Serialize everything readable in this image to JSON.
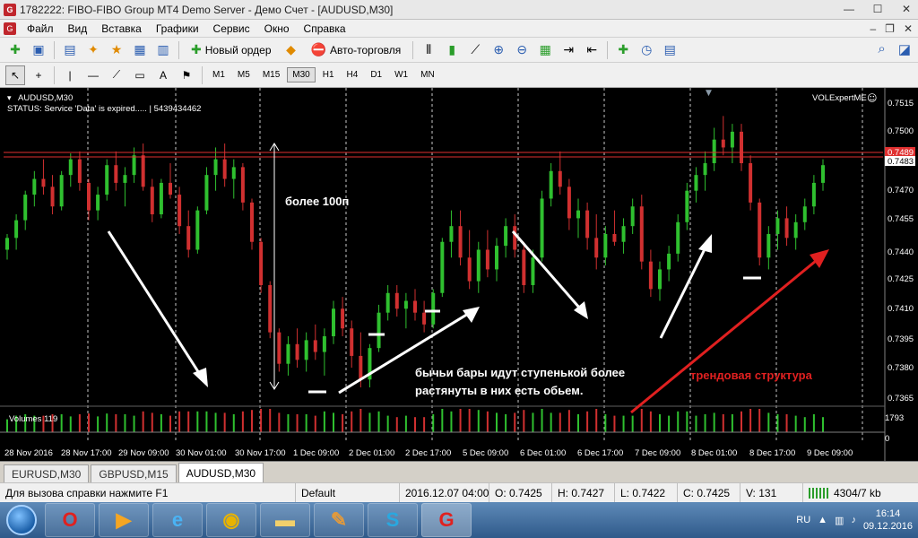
{
  "window": {
    "title": "1782222: FIBO-FIBO Group MT4 Demo Server - Демо Счет - [AUDUSD,M30]",
    "icon": "G"
  },
  "menu": [
    "Файл",
    "Вид",
    "Вставка",
    "Графики",
    "Сервис",
    "Окно",
    "Справка"
  ],
  "toolbar": {
    "new_order": "Новый ордер",
    "auto_trading": "Авто-торговля"
  },
  "draw_tools": [
    "↖",
    "+",
    "|",
    "—",
    "⟋",
    "▭",
    "A",
    "⚑"
  ],
  "timeframes": [
    "M1",
    "M5",
    "M15",
    "M30",
    "H1",
    "H4",
    "D1",
    "W1",
    "MN"
  ],
  "active_timeframe": "M30",
  "chart": {
    "symbol_line": "AUDUSD,M30",
    "status_line": "STATUS:  Service 'Data' is expired.....  | 5439434462",
    "expert": "VOLExpertME",
    "volumes_label": "Volumes 119",
    "volume_scale_top": "1793",
    "volume_scale_bottom": "0",
    "price_axis": [
      "0.7515",
      "0.7500",
      "0.7485",
      "0.7470",
      "0.7455",
      "0.7440",
      "0.7425",
      "0.7410",
      "0.7395",
      "0.7380",
      "0.7365"
    ],
    "price_label_red": "0.7489",
    "price_label_current": "0.7483",
    "time_axis": [
      "28 Nov 2016",
      "28 Nov 17:00",
      "29 Nov 09:00",
      "30 Nov 01:00",
      "30 Nov 17:00",
      "1 Dec 09:00",
      "2 Dec 01:00",
      "2 Dec 17:00",
      "5 Dec 09:00",
      "6 Dec 01:00",
      "6 Dec 17:00",
      "7 Dec 09:00",
      "8 Dec 01:00",
      "8 Dec 17:00",
      "9 Dec 09:00"
    ],
    "annotation_range": "более 100п",
    "annotation_bull": "бычьи бары идут ступенькой более растянуты в них есть обьем.",
    "annotation_trend": "трендовая структура"
  },
  "tabs": [
    "EURUSD,M30",
    "GBPUSD,M15",
    "AUDUSD,M30"
  ],
  "active_tab": "AUDUSD,M30",
  "status": {
    "help": "Для вызова справки нажмите F1",
    "profile": "Default",
    "datetime": "2016.12.07 04:00",
    "open": "O: 0.7425",
    "high": "H: 0.7427",
    "low": "L: 0.7422",
    "close": "C: 0.7425",
    "volume": "V: 131",
    "traffic": "4304/7 kb"
  },
  "taskbar": {
    "lang": "RU",
    "time": "16:14",
    "date": "09.12.2016"
  },
  "colors": {
    "bull": "#2fc02f",
    "bear": "#d03030",
    "level_line": "#e03030",
    "arrow_white": "#ffffff",
    "arrow_red": "#e02020"
  },
  "candles": [
    [
      0.744,
      0.7448,
      0.7435,
      0.7446
    ],
    [
      0.7446,
      0.7458,
      0.744,
      0.7455
    ],
    [
      0.7455,
      0.747,
      0.745,
      0.7468
    ],
    [
      0.7468,
      0.748,
      0.7462,
      0.7476
    ],
    [
      0.7476,
      0.7486,
      0.7468,
      0.7472
    ],
    [
      0.7472,
      0.7478,
      0.7458,
      0.7462
    ],
    [
      0.7462,
      0.748,
      0.746,
      0.7478
    ],
    [
      0.7478,
      0.7489,
      0.7472,
      0.7486
    ],
    [
      0.7486,
      0.749,
      0.747,
      0.7474
    ],
    [
      0.7474,
      0.7476,
      0.7455,
      0.746
    ],
    [
      0.746,
      0.7472,
      0.7455,
      0.7468
    ],
    [
      0.7468,
      0.7486,
      0.7465,
      0.7483
    ],
    [
      0.7483,
      0.749,
      0.747,
      0.7474
    ],
    [
      0.7474,
      0.7482,
      0.7462,
      0.7478
    ],
    [
      0.7478,
      0.7492,
      0.7474,
      0.7488
    ],
    [
      0.7488,
      0.7494,
      0.747,
      0.7472
    ],
    [
      0.7472,
      0.7476,
      0.7454,
      0.7458
    ],
    [
      0.7458,
      0.7476,
      0.7456,
      0.7474
    ],
    [
      0.7474,
      0.7484,
      0.7466,
      0.7468
    ],
    [
      0.7468,
      0.7472,
      0.7448,
      0.7452
    ],
    [
      0.7452,
      0.746,
      0.7436,
      0.744
    ],
    [
      0.744,
      0.7462,
      0.7438,
      0.746
    ],
    [
      0.746,
      0.7482,
      0.7458,
      0.7478
    ],
    [
      0.7478,
      0.7492,
      0.747,
      0.7486
    ],
    [
      0.7486,
      0.7494,
      0.7472,
      0.7476
    ],
    [
      0.7476,
      0.7486,
      0.7466,
      0.7482
    ],
    [
      0.7482,
      0.7484,
      0.746,
      0.7464
    ],
    [
      0.7464,
      0.7466,
      0.744,
      0.7444
    ],
    [
      0.7444,
      0.7446,
      0.7418,
      0.7422
    ],
    [
      0.7422,
      0.7424,
      0.7395,
      0.7398
    ],
    [
      0.7398,
      0.74,
      0.7378,
      0.7382
    ],
    [
      0.7382,
      0.7396,
      0.7376,
      0.7392
    ],
    [
      0.7392,
      0.74,
      0.738,
      0.7384
    ],
    [
      0.7384,
      0.7398,
      0.7378,
      0.7394
    ],
    [
      0.7394,
      0.7402,
      0.7384,
      0.7388
    ],
    [
      0.7388,
      0.74,
      0.7376,
      0.7396
    ],
    [
      0.7396,
      0.7414,
      0.7392,
      0.741
    ],
    [
      0.741,
      0.7416,
      0.7396,
      0.74
    ],
    [
      0.74,
      0.7404,
      0.738,
      0.7386
    ],
    [
      0.7386,
      0.7398,
      0.737,
      0.7374
    ],
    [
      0.7374,
      0.7392,
      0.737,
      0.739
    ],
    [
      0.739,
      0.7412,
      0.7388,
      0.7408
    ],
    [
      0.7408,
      0.7422,
      0.7404,
      0.7418
    ],
    [
      0.7418,
      0.7422,
      0.7406,
      0.741
    ],
    [
      0.741,
      0.7418,
      0.74,
      0.7414
    ],
    [
      0.7414,
      0.742,
      0.7404,
      0.7408
    ],
    [
      0.7408,
      0.7414,
      0.7398,
      0.7402
    ],
    [
      0.7402,
      0.742,
      0.74,
      0.7418
    ],
    [
      0.7418,
      0.7446,
      0.7416,
      0.7444
    ],
    [
      0.7444,
      0.746,
      0.7436,
      0.7452
    ],
    [
      0.7452,
      0.746,
      0.7432,
      0.7436
    ],
    [
      0.7436,
      0.745,
      0.742,
      0.7424
    ],
    [
      0.7424,
      0.7444,
      0.7418,
      0.744
    ],
    [
      0.744,
      0.745,
      0.7426,
      0.743
    ],
    [
      0.743,
      0.7446,
      0.7424,
      0.7442
    ],
    [
      0.7442,
      0.7456,
      0.7436,
      0.7452
    ],
    [
      0.7452,
      0.7458,
      0.7436,
      0.744
    ],
    [
      0.744,
      0.7444,
      0.7418,
      0.7422
    ],
    [
      0.7422,
      0.744,
      0.7418,
      0.7436
    ],
    [
      0.7436,
      0.747,
      0.7434,
      0.7466
    ],
    [
      0.7466,
      0.7484,
      0.7462,
      0.748
    ],
    [
      0.748,
      0.749,
      0.7468,
      0.7472
    ],
    [
      0.7472,
      0.7476,
      0.745,
      0.7456
    ],
    [
      0.7456,
      0.7466,
      0.7446,
      0.746
    ],
    [
      0.746,
      0.7464,
      0.744,
      0.7446
    ],
    [
      0.7446,
      0.7458,
      0.743,
      0.7436
    ],
    [
      0.7436,
      0.7452,
      0.7432,
      0.7448
    ],
    [
      0.7448,
      0.746,
      0.7442,
      0.7444
    ],
    [
      0.7444,
      0.7456,
      0.7438,
      0.7452
    ],
    [
      0.7452,
      0.7466,
      0.7448,
      0.7462
    ],
    [
      0.7462,
      0.7468,
      0.743,
      0.7434
    ],
    [
      0.7434,
      0.744,
      0.7416,
      0.742
    ],
    [
      0.742,
      0.7434,
      0.7414,
      0.743
    ],
    [
      0.743,
      0.7442,
      0.7424,
      0.7438
    ],
    [
      0.7438,
      0.7458,
      0.7434,
      0.7454
    ],
    [
      0.7454,
      0.7474,
      0.745,
      0.747
    ],
    [
      0.747,
      0.7482,
      0.7464,
      0.7478
    ],
    [
      0.7478,
      0.749,
      0.747,
      0.7484
    ],
    [
      0.7484,
      0.7502,
      0.748,
      0.7496
    ],
    [
      0.7496,
      0.7508,
      0.7488,
      0.7492
    ],
    [
      0.7492,
      0.7504,
      0.7484,
      0.75
    ],
    [
      0.75,
      0.7504,
      0.748,
      0.7484
    ],
    [
      0.7484,
      0.7488,
      0.746,
      0.7464
    ],
    [
      0.7464,
      0.7466,
      0.7432,
      0.7436
    ],
    [
      0.7436,
      0.7452,
      0.743,
      0.7448
    ],
    [
      0.7448,
      0.746,
      0.744,
      0.7456
    ],
    [
      0.7456,
      0.7462,
      0.7442,
      0.7446
    ],
    [
      0.7446,
      0.7458,
      0.744,
      0.7454
    ],
    [
      0.7454,
      0.7466,
      0.745,
      0.7462
    ],
    [
      0.7462,
      0.7478,
      0.7458,
      0.7474
    ],
    [
      0.7474,
      0.7486,
      0.747,
      0.7483
    ]
  ]
}
